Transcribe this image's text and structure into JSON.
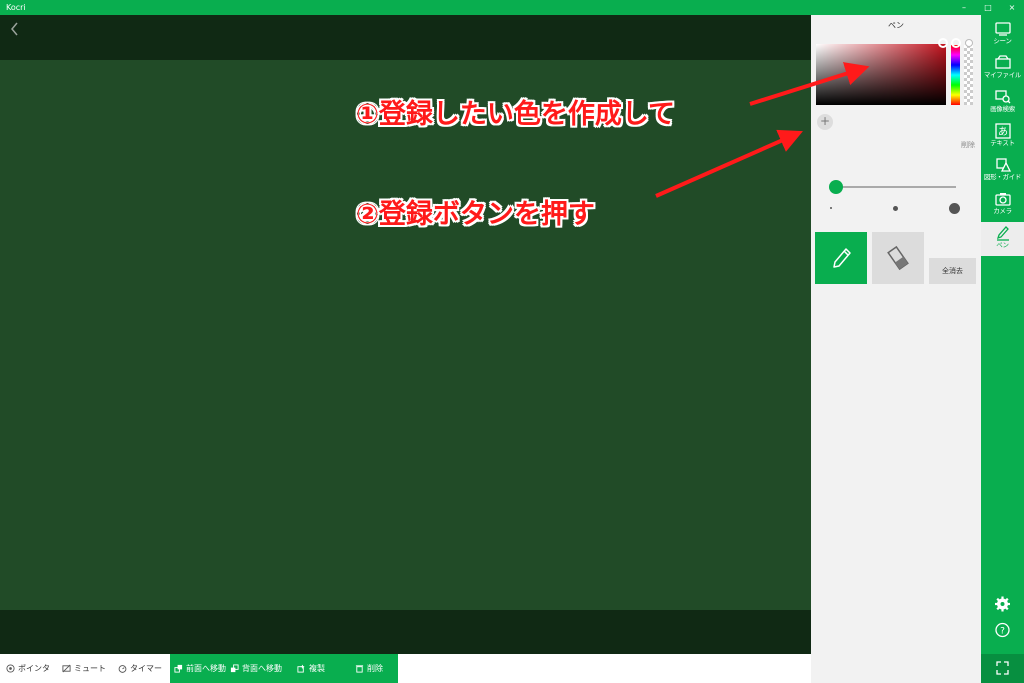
{
  "app": {
    "title": "Kocri",
    "window_buttons": [
      "–",
      "□",
      "×"
    ]
  },
  "toolbar": {
    "plain_items": [
      {
        "label": "ポインタ",
        "icon": "pointer-icon"
      },
      {
        "label": "ミュート",
        "icon": "mute-icon"
      },
      {
        "label": "タイマー",
        "icon": "timer-icon"
      }
    ],
    "green_items": [
      {
        "label": "前面へ移動",
        "icon": "bring-front-icon"
      },
      {
        "label": "背面へ移動",
        "icon": "send-back-icon"
      },
      {
        "label": "複製",
        "icon": "duplicate-icon"
      },
      {
        "label": "削除",
        "icon": "trash-icon"
      }
    ]
  },
  "pen_panel": {
    "title": "ペン",
    "add_color_symbol": "+",
    "delete_label": "削除",
    "clear_all_label": "全消去",
    "active_tool": "pen",
    "selected_color": "#c2121d"
  },
  "sidebar": {
    "items": [
      {
        "label": "シーン",
        "icon": "scene-icon"
      },
      {
        "label": "マイファイル",
        "icon": "myfile-icon"
      },
      {
        "label": "画像検索",
        "icon": "image-search-icon"
      },
      {
        "label": "テキスト",
        "icon": "text-icon"
      },
      {
        "label": "図形・ガイド",
        "icon": "shape-guide-icon"
      },
      {
        "label": "カメラ",
        "icon": "camera-icon"
      },
      {
        "label": "ペン",
        "icon": "pen-icon"
      }
    ]
  },
  "annotations": {
    "step1": "①登録したい色を作成して",
    "step2": "②登録ボタンを押す"
  },
  "colors": {
    "brand": "#09ae4f",
    "board": "#214b27",
    "annotation": "#ff1a1a"
  }
}
